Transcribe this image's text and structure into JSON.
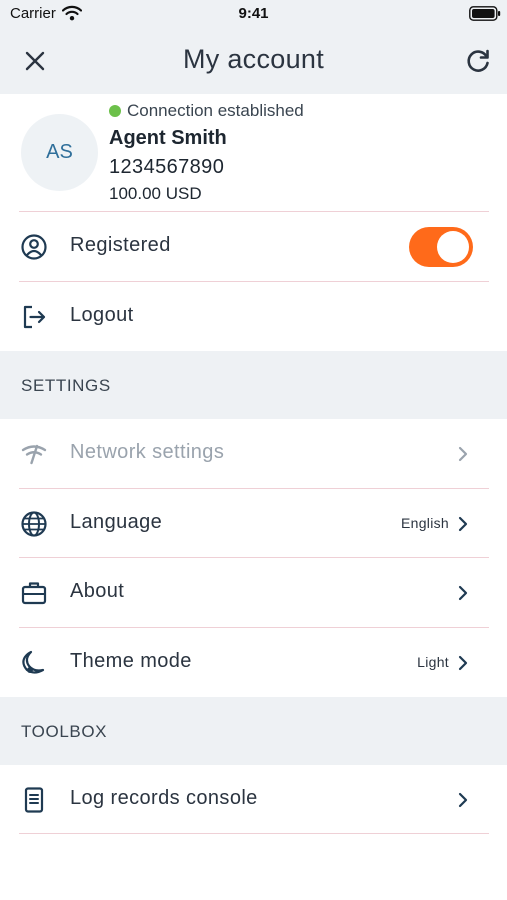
{
  "status_bar": {
    "carrier": "Carrier",
    "time": "9:41"
  },
  "header": {
    "title": "My account"
  },
  "profile": {
    "initials": "AS",
    "connection_status": "Connection established",
    "name": "Agent Smith",
    "number": "1234567890",
    "balance": "100.00 USD"
  },
  "account": {
    "registered_label": "Registered",
    "registered_on": true,
    "logout_label": "Logout"
  },
  "settings": {
    "title": "SETTINGS",
    "network_label": "Network settings",
    "language_label": "Language",
    "language_value": "English",
    "about_label": "About",
    "theme_label": "Theme mode",
    "theme_value": "Light"
  },
  "toolbox": {
    "title": "TOOLBOX",
    "log_label": "Log records console"
  },
  "colors": {
    "accent": "#ff6a1a",
    "connected": "#6cc04a",
    "header_bg": "#eef1f4",
    "divider": "#efd0d6"
  }
}
